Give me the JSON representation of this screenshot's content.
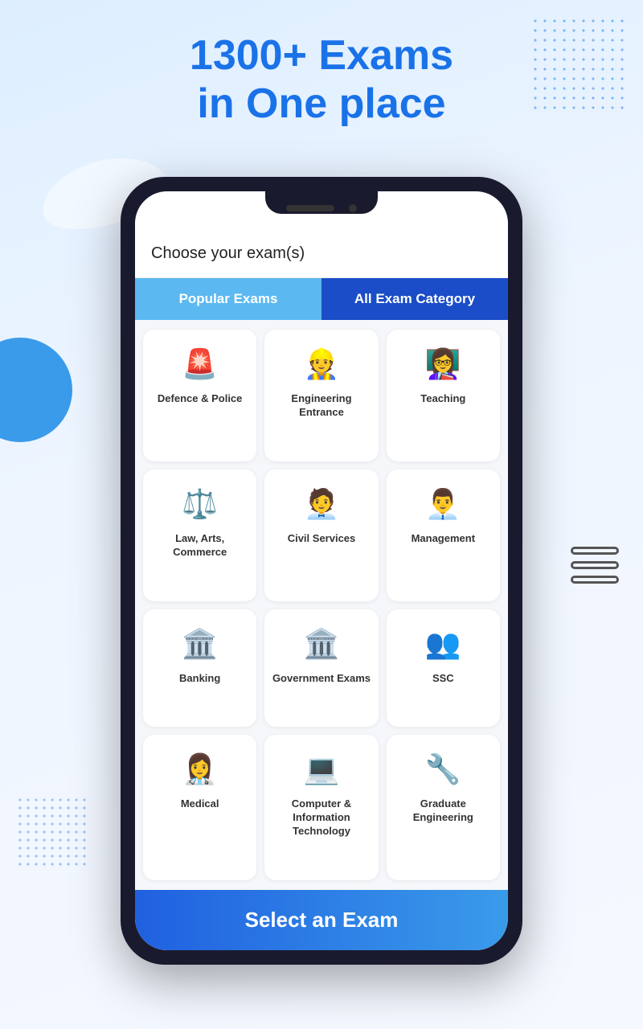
{
  "heading": {
    "line1": "1300+ Exams",
    "line2": "in One place"
  },
  "phone": {
    "choose_label": "Choose your exam(s)",
    "tab_popular": "Popular Exams",
    "tab_all": "All Exam Category",
    "select_button": "Select an Exam"
  },
  "categories": [
    {
      "id": "defence-police",
      "label": "Defence &\nPolice",
      "icon": "🚨"
    },
    {
      "id": "engineering-entrance",
      "label": "Engineering\nEntrance",
      "icon": "👷"
    },
    {
      "id": "teaching",
      "label": "Teaching",
      "icon": "👩‍🏫"
    },
    {
      "id": "law-arts-commerce",
      "label": "Law, Arts,\nCommerce",
      "icon": "⚖️"
    },
    {
      "id": "civil-services",
      "label": "Civil Services",
      "icon": "🧑‍💼"
    },
    {
      "id": "management",
      "label": "Management",
      "icon": "👨‍💼"
    },
    {
      "id": "banking",
      "label": "Banking",
      "icon": "🏛️"
    },
    {
      "id": "government-exams",
      "label": "Government\nExams",
      "icon": "🏛️"
    },
    {
      "id": "ssc",
      "label": "SSC",
      "icon": "👥"
    },
    {
      "id": "medical",
      "label": "Medical",
      "icon": "👩‍⚕️"
    },
    {
      "id": "computer-it",
      "label": "Computer &\nInformation\nTechnology",
      "icon": "💻"
    },
    {
      "id": "graduate-engineering",
      "label": "Graduate\nEngineering",
      "icon": "🔧"
    }
  ]
}
